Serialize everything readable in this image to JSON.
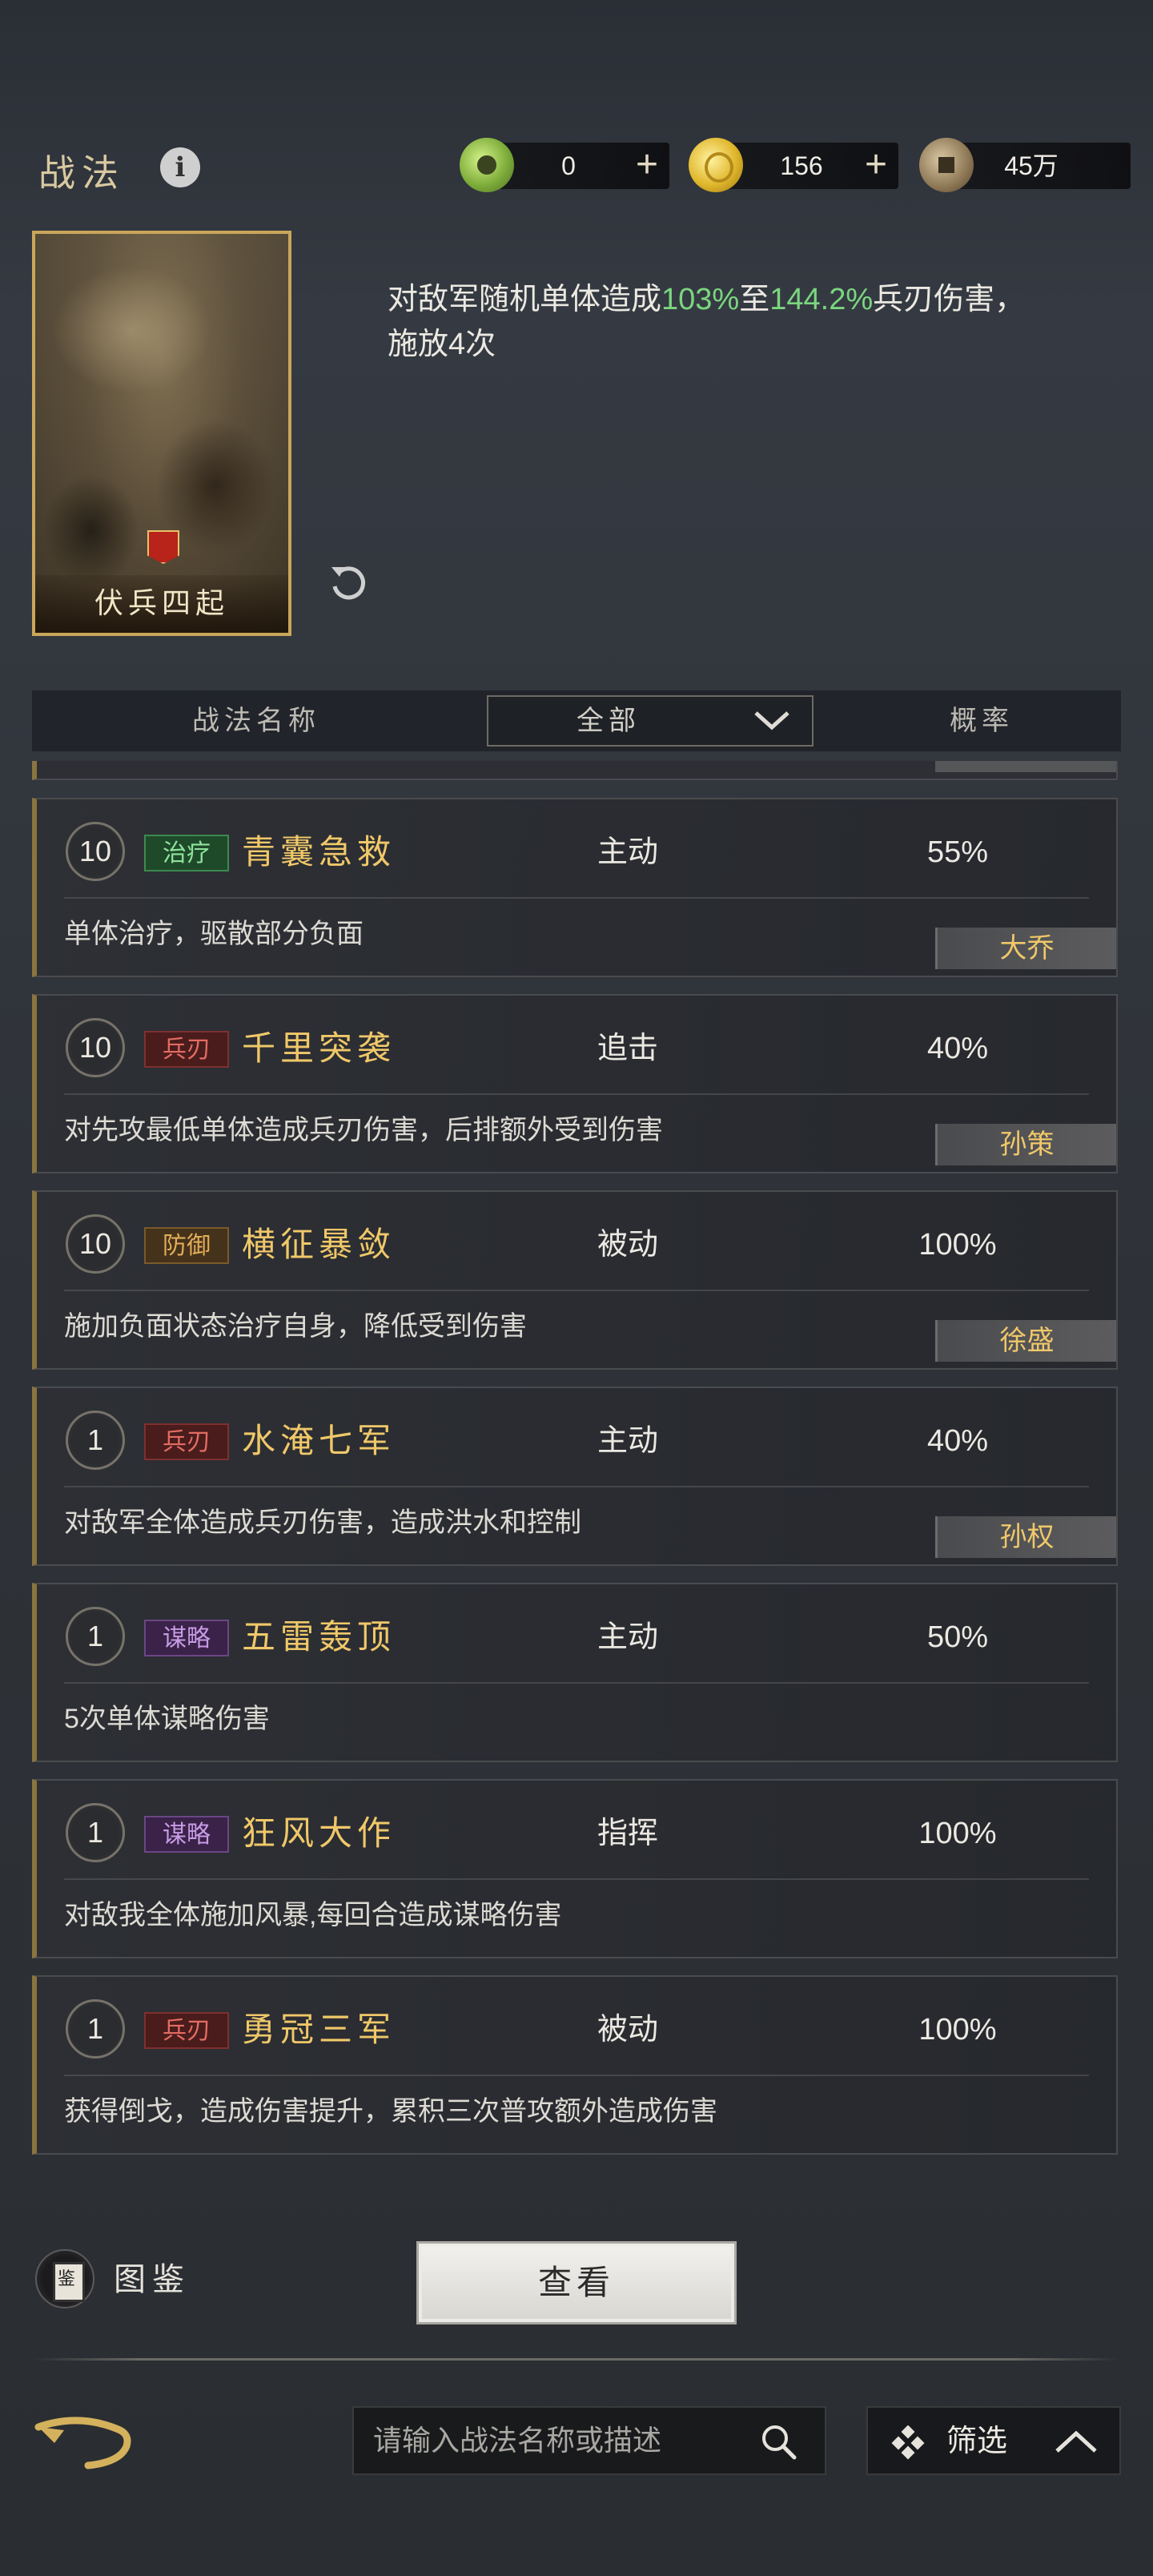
{
  "header": {
    "title": "战法",
    "info_icon": "i",
    "resources": [
      {
        "icon": "jade-coin-icon",
        "value": "0",
        "has_plus": true
      },
      {
        "icon": "gold-coin-icon",
        "value": "156",
        "has_plus": true
      },
      {
        "icon": "copper-coin-icon",
        "value": "45万",
        "has_plus": false
      }
    ]
  },
  "selected_skill": {
    "name": "伏兵四起",
    "desc_parts": [
      "对敌军随机单体造成",
      "103%",
      "至",
      "144.2%",
      "兵刃伤害，施放4次"
    ],
    "highlight_color": "#7bd67f"
  },
  "table_header": {
    "name_col": "战法名称",
    "filter_value": "全部",
    "rate_col": "概率"
  },
  "skills": [
    {
      "level": "10",
      "tag": "治疗",
      "tag_type": "heal",
      "name": "青囊急救",
      "type": "主动",
      "rate": "55%",
      "desc": "单体治疗，驱散部分负面",
      "hero": "大乔"
    },
    {
      "level": "10",
      "tag": "兵刃",
      "tag_type": "blade",
      "name": "千里突袭",
      "type": "追击",
      "rate": "40%",
      "desc": "对先攻最低单体造成兵刃伤害，后排额外受到伤害",
      "hero": "孙策"
    },
    {
      "level": "10",
      "tag": "防御",
      "tag_type": "def",
      "name": "横征暴敛",
      "type": "被动",
      "rate": "100%",
      "desc": "施加负面状态治疗自身，降低受到伤害",
      "hero": "徐盛"
    },
    {
      "level": "1",
      "tag": "兵刃",
      "tag_type": "blade",
      "name": "水淹七军",
      "type": "主动",
      "rate": "40%",
      "desc": "对敌军全体造成兵刃伤害，造成洪水和控制",
      "hero": "孙权"
    },
    {
      "level": "1",
      "tag": "谋略",
      "tag_type": "strat",
      "name": "五雷轰顶",
      "type": "主动",
      "rate": "50%",
      "desc": "5次单体谋略伤害",
      "hero": ""
    },
    {
      "level": "1",
      "tag": "谋略",
      "tag_type": "strat",
      "name": "狂风大作",
      "type": "指挥",
      "rate": "100%",
      "desc": "对敌我全体施加风暴,每回合造成谋略伤害",
      "hero": ""
    },
    {
      "level": "1",
      "tag": "兵刃",
      "tag_type": "blade",
      "name": "勇冠三军",
      "type": "被动",
      "rate": "100%",
      "desc": "获得倒戈，造成伤害提升，累积三次普攻额外造成伤害",
      "hero": ""
    }
  ],
  "bottom": {
    "tujian_icon_char": "鉴",
    "tujian_label": "图鉴",
    "view_button": "查看",
    "search_placeholder": "请输入战法名称或描述",
    "filter_label": "筛选"
  }
}
